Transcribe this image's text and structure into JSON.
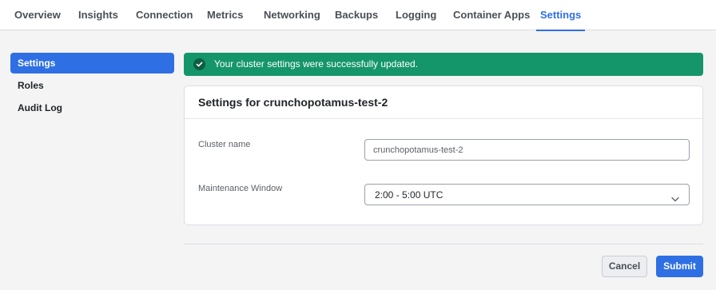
{
  "nav": {
    "tabs": [
      {
        "label": "Overview"
      },
      {
        "label": "Insights"
      },
      {
        "label": "Connection"
      },
      {
        "label": "Metrics"
      },
      {
        "label": "Networking"
      },
      {
        "label": "Backups"
      },
      {
        "label": "Logging"
      },
      {
        "label": "Container Apps"
      },
      {
        "label": "Settings",
        "active": true
      }
    ]
  },
  "sidebar": {
    "items": [
      {
        "label": "Settings",
        "active": true
      },
      {
        "label": "Roles"
      },
      {
        "label": "Audit Log"
      }
    ]
  },
  "alert": {
    "icon": "check-circle-icon",
    "message": "Your cluster settings were successfully updated."
  },
  "card": {
    "title": "Settings for crunchopotamus-test-2",
    "cluster_name": {
      "label": "Cluster name",
      "value": "crunchopotamus-test-2"
    },
    "maintenance_window": {
      "label": "Maintenance Window",
      "selected": "2:00 - 5:00 UTC"
    }
  },
  "actions": {
    "cancel_label": "Cancel",
    "submit_label": "Submit"
  },
  "colors": {
    "accent": "#2f6fe4",
    "success": "#15966a"
  }
}
